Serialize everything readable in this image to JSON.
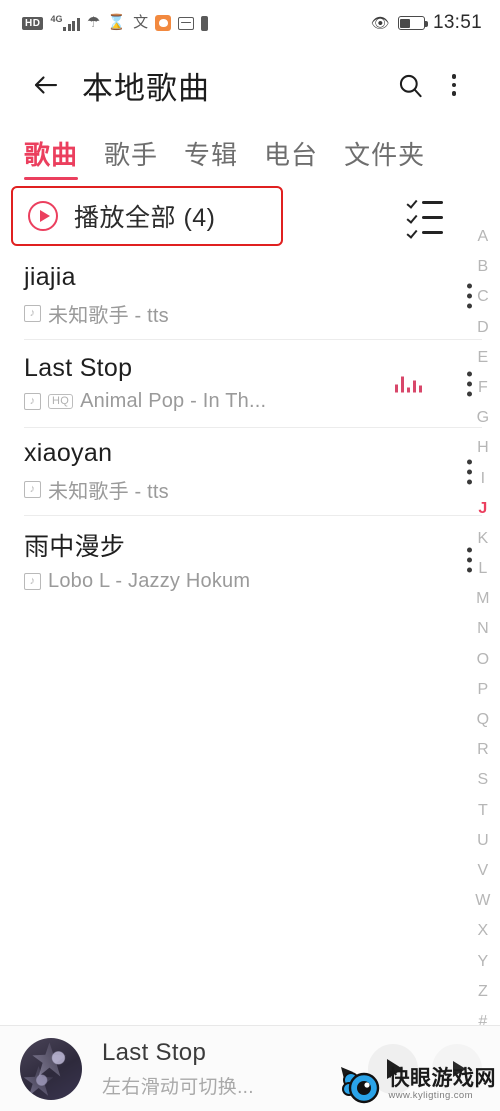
{
  "status_bar": {
    "hd_label": "HD",
    "network_label": "4G",
    "icons": [
      "hd-badge",
      "signal-bars",
      "wifi",
      "hourglass",
      "input-method",
      "weather-app",
      "mail",
      "battery-small"
    ],
    "right_icons": [
      "eye-comfort",
      "battery"
    ],
    "time": "13:51"
  },
  "appbar": {
    "back_icon": "arrow-left-icon",
    "title": "本地歌曲",
    "search_icon": "search-icon",
    "more_icon": "kebab-menu-icon"
  },
  "tabs": [
    {
      "label": "歌曲",
      "active": true
    },
    {
      "label": "歌手",
      "active": false
    },
    {
      "label": "专辑",
      "active": false
    },
    {
      "label": "电台",
      "active": false
    },
    {
      "label": "文件夹",
      "active": false
    }
  ],
  "toolbar": {
    "play_all_label": "播放全部 (4)",
    "play_icon": "play-circle-icon",
    "multiselect_icon": "checklist-icon",
    "highlight_color": "#e02020",
    "accent_color": "#eb3f5e"
  },
  "songs": [
    {
      "title": "jiajia",
      "subtitle": "未知歌手 - tts",
      "has_hq": false,
      "playing": false
    },
    {
      "title": "Last Stop",
      "subtitle": "Animal Pop - In Th...",
      "has_hq": true,
      "hq_label": "HQ",
      "playing": true
    },
    {
      "title": "xiaoyan",
      "subtitle": "未知歌手 - tts",
      "has_hq": false,
      "playing": false
    },
    {
      "title": "雨中漫步",
      "subtitle": "Lobo L - Jazzy Hokum",
      "has_hq": false,
      "playing": false
    }
  ],
  "alpha_index": {
    "letters": [
      "A",
      "B",
      "C",
      "D",
      "E",
      "F",
      "G",
      "H",
      "I",
      "J",
      "K",
      "L",
      "M",
      "N",
      "O",
      "P",
      "Q",
      "R",
      "S",
      "T",
      "U",
      "V",
      "W",
      "X",
      "Y",
      "Z",
      "#"
    ],
    "active": "J"
  },
  "player": {
    "track_name": "Last Stop",
    "hint": "左右滑动可切换...",
    "play_icon": "play-icon",
    "next_icon": "next-icon",
    "artwork": "album-art"
  },
  "watermark": {
    "name": "快眼游戏网",
    "url": "www.kyligting.com"
  }
}
